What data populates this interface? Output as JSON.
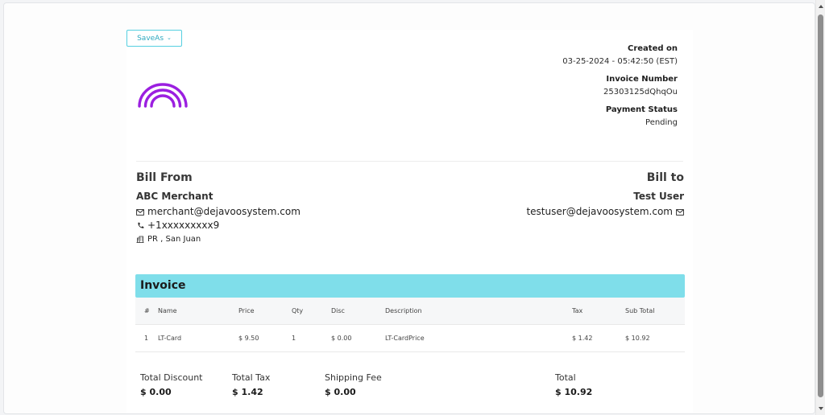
{
  "toolbar": {
    "saveas_label": "SaveAs"
  },
  "meta": {
    "created_label": "Created on",
    "created_value": "03-25-2024 - 05:42:50 (EST)",
    "invoice_number_label": "Invoice Number",
    "invoice_number_value": "25303125dQhqOu",
    "payment_status_label": "Payment Status",
    "payment_status_value": "Pending"
  },
  "bill_from": {
    "title": "Bill From",
    "name": "ABC Merchant",
    "email": "merchant@dejavoosystem.com",
    "phone": "+1xxxxxxxxx9",
    "address": "PR , San Juan"
  },
  "bill_to": {
    "title": "Bill to",
    "name": "Test User",
    "email": "testuser@dejavoosystem.com"
  },
  "invoice": {
    "title": "Invoice",
    "columns": [
      "#",
      "Name",
      "Price",
      "Qty",
      "Disc",
      "Description",
      "Tax",
      "Sub Total"
    ],
    "rows": [
      [
        "1",
        "LT-Card",
        "$ 9.50",
        "1",
        "$ 0.00",
        "LT-CardPrice",
        "$ 1.42",
        "$ 10.92"
      ]
    ]
  },
  "totals": {
    "discount_label": "Total Discount",
    "discount_value": "$ 0.00",
    "tax_label": "Total Tax",
    "tax_value": "$ 1.42",
    "shipping_label": "Shipping Fee",
    "shipping_value": "$ 0.00",
    "total_label": "Total",
    "total_value": "$ 10.92"
  },
  "colors": {
    "accent": "#7fdeea",
    "brand_logo": "#9b1fe0",
    "button_border": "#55cfe0"
  },
  "icons": {
    "email": "mail-icon",
    "phone": "phone-icon",
    "address": "building-icon",
    "logo": "rainbow-logo-icon"
  }
}
